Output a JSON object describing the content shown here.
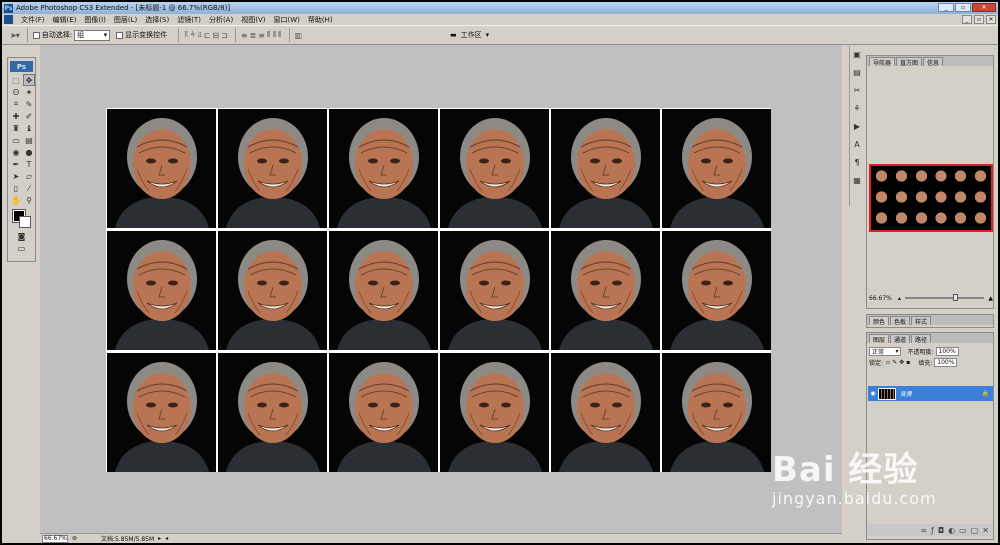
{
  "window": {
    "title": "Adobe Photoshop CS3 Extended - [未标题-1 @ 66.7%(RGB/8)]",
    "app_icon": "Ps",
    "buttons": {
      "minimize": "_",
      "restore": "▫",
      "close": "✕"
    }
  },
  "menu": {
    "items": [
      "文件(F)",
      "编辑(E)",
      "图像(I)",
      "图层(L)",
      "选择(S)",
      "滤镜(T)",
      "分析(A)",
      "视图(V)",
      "窗口(W)",
      "帮助(H)"
    ],
    "doc_buttons": {
      "minimize": "_",
      "restore": "▫",
      "close": "✕"
    }
  },
  "options": {
    "auto_select_label": "自动选择:",
    "auto_select_value": "组",
    "show_transform_label": "显示变换控件",
    "workspace_label": "工作区"
  },
  "toolbox": {
    "logo": "Ps",
    "tools": [
      {
        "name": "marquee-tool-icon",
        "glyph": "⬚"
      },
      {
        "name": "move-tool-icon",
        "glyph": "✥"
      },
      {
        "name": "lasso-tool-icon",
        "glyph": "ʘ"
      },
      {
        "name": "magic-wand-icon",
        "glyph": "✦"
      },
      {
        "name": "crop-tool-icon",
        "glyph": "⌗"
      },
      {
        "name": "slice-tool-icon",
        "glyph": "✎"
      },
      {
        "name": "healing-brush-icon",
        "glyph": "✚"
      },
      {
        "name": "brush-tool-icon",
        "glyph": "✐"
      },
      {
        "name": "stamp-tool-icon",
        "glyph": "♜"
      },
      {
        "name": "history-brush-icon",
        "glyph": "♝"
      },
      {
        "name": "eraser-tool-icon",
        "glyph": "▭"
      },
      {
        "name": "gradient-tool-icon",
        "glyph": "▤"
      },
      {
        "name": "blur-tool-icon",
        "glyph": "◉"
      },
      {
        "name": "dodge-tool-icon",
        "glyph": "●"
      },
      {
        "name": "pen-tool-icon",
        "glyph": "✒"
      },
      {
        "name": "type-tool-icon",
        "glyph": "T"
      },
      {
        "name": "path-select-icon",
        "glyph": "➤"
      },
      {
        "name": "shape-tool-icon",
        "glyph": "▱"
      },
      {
        "name": "notes-tool-icon",
        "glyph": "▯"
      },
      {
        "name": "eyedropper-icon",
        "glyph": "⁄"
      },
      {
        "name": "hand-tool-icon",
        "glyph": "✋"
      },
      {
        "name": "zoom-tool-icon",
        "glyph": "⚲"
      }
    ]
  },
  "status": {
    "zoom": "66.67%",
    "doc_size": "文档:5.85M/5.85M"
  },
  "navigator": {
    "tabs": [
      "导航器",
      "直方图",
      "信息"
    ],
    "zoom": "66.67%"
  },
  "color_panel": {
    "tabs": [
      "颜色",
      "色板",
      "样式"
    ]
  },
  "layers": {
    "tabs": [
      "图层",
      "通道",
      "路径"
    ],
    "blend_mode": "正常",
    "opacity_label": "不透明度:",
    "opacity_value": "100%",
    "lock_label": "锁定:",
    "fill_label": "填充:",
    "fill_value": "100%",
    "layer_name": "背景"
  },
  "watermark": {
    "main": "Bai 经验",
    "sub": "jingyan.baidu.com"
  }
}
